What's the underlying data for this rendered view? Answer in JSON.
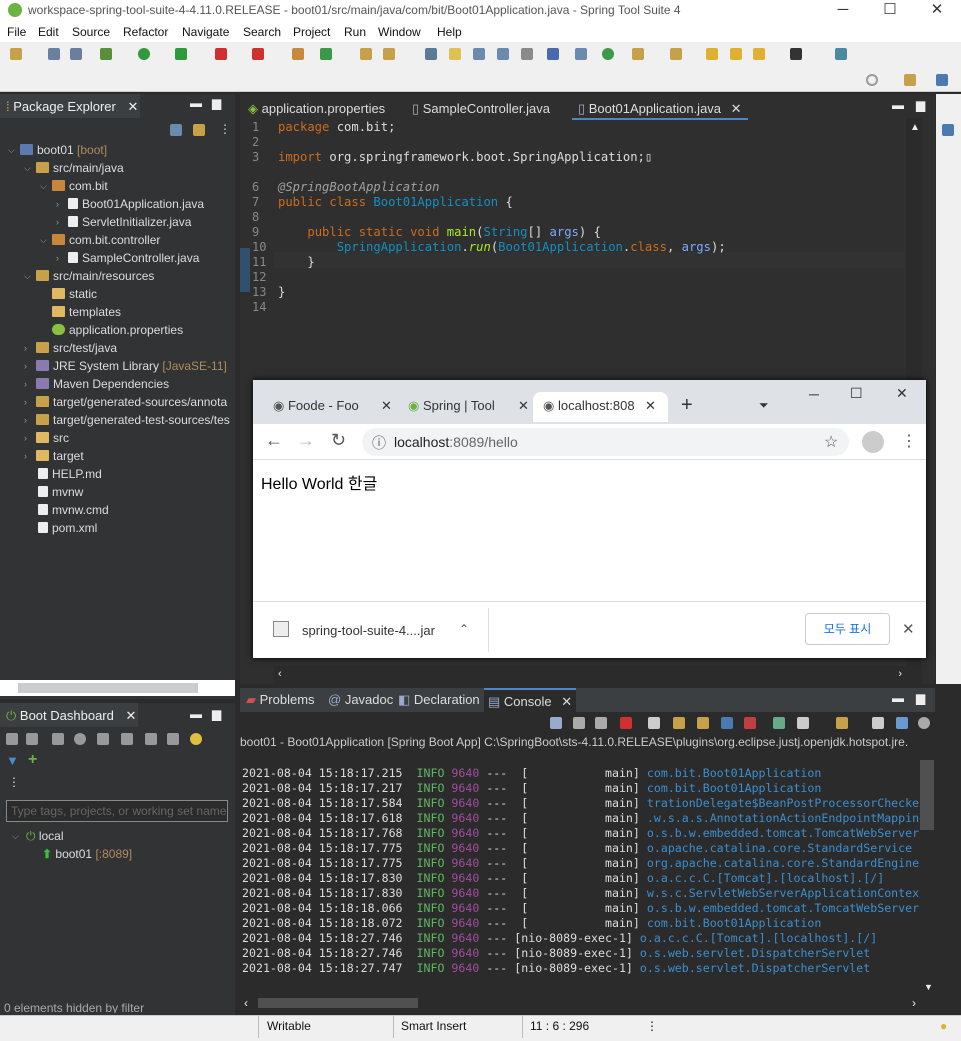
{
  "window": {
    "title": "workspace-spring-tool-suite-4-4.11.0.RELEASE - boot01/src/main/java/com/bit/Boot01Application.java - Spring Tool Suite 4",
    "minimize": "─",
    "maximize": "☐",
    "close": "✕"
  },
  "menu": [
    "File",
    "Edit",
    "Source",
    "Refactor",
    "Navigate",
    "Search",
    "Project",
    "Run",
    "Window",
    "Help"
  ],
  "package_explorer": {
    "title": "Package Explorer",
    "close": "✕",
    "items": [
      {
        "label": "boot01",
        "suffix": "[boot]"
      },
      {
        "label": "src/main/java"
      },
      {
        "label": "com.bit"
      },
      {
        "label": "Boot01Application.java"
      },
      {
        "label": "ServletInitializer.java"
      },
      {
        "label": "com.bit.controller"
      },
      {
        "label": "SampleController.java"
      },
      {
        "label": "src/main/resources"
      },
      {
        "label": "static"
      },
      {
        "label": "templates"
      },
      {
        "label": "application.properties"
      },
      {
        "label": "src/test/java"
      },
      {
        "label": "JRE System Library",
        "suffix": "[JavaSE-11]"
      },
      {
        "label": "Maven Dependencies"
      },
      {
        "label": "target/generated-sources/annota"
      },
      {
        "label": "target/generated-test-sources/tes"
      },
      {
        "label": "src"
      },
      {
        "label": "target"
      },
      {
        "label": "HELP.md"
      },
      {
        "label": "mvnw"
      },
      {
        "label": "mvnw.cmd"
      },
      {
        "label": "pom.xml"
      }
    ]
  },
  "editor": {
    "tabs": [
      "application.properties",
      "SampleController.java",
      "Boot01Application.java"
    ],
    "active_close": "✕",
    "line_numbers": [
      "1",
      "2",
      "3",
      "6",
      "7",
      "8",
      "9",
      "10",
      "11",
      "12",
      "13",
      "14"
    ]
  },
  "browser": {
    "tabs": [
      "Foode - Foo",
      "Spring | Tool",
      "localhost:808"
    ],
    "tab_close": "✕",
    "new_tab": "+",
    "url_host": "localhost",
    "url_rest": ":8089/hello",
    "content": "Hello World 한글",
    "download": {
      "file": "spring-tool-suite-4....jar",
      "show_all": "모두 표시",
      "close": "✕"
    },
    "window": {
      "min": "─",
      "max": "☐",
      "close": "✕"
    }
  },
  "boot_dashboard": {
    "title": "Boot Dashboard",
    "close": "✕",
    "filter_placeholder": "Type tags, projects, or working set name",
    "local": "local",
    "app": "boot01",
    "app_port": "[:8089]",
    "hidden": "0 elements hidden by filter"
  },
  "bottom_tabs": [
    "Problems",
    "Javadoc",
    "Declaration",
    "Console"
  ],
  "console": {
    "header": "boot01 - Boot01Application [Spring Boot App] C:\\SpringBoot\\sts-4.11.0.RELEASE\\plugins\\org.eclipse.justj.openjdk.hotspot.jre.",
    "lines": [
      {
        "ts": "2021-08-04 15:18:17.215",
        "lvl": "INFO",
        "pid": "9640",
        "thread": "---  [           main]",
        "logger": "com.bit.Boot01Application"
      },
      {
        "ts": "2021-08-04 15:18:17.217",
        "lvl": "INFO",
        "pid": "9640",
        "thread": "---  [           main]",
        "logger": "com.bit.Boot01Application"
      },
      {
        "ts": "2021-08-04 15:18:17.584",
        "lvl": "INFO",
        "pid": "9640",
        "thread": "---  [           main]",
        "logger": "trationDelegate$BeanPostProcessorChecker"
      },
      {
        "ts": "2021-08-04 15:18:17.618",
        "lvl": "INFO",
        "pid": "9640",
        "thread": "---  [           main]",
        "logger": ".w.s.a.s.AnnotationActionEndpointMapping"
      },
      {
        "ts": "2021-08-04 15:18:17.768",
        "lvl": "INFO",
        "pid": "9640",
        "thread": "---  [           main]",
        "logger": "o.s.b.w.embedded.tomcat.TomcatWebServer"
      },
      {
        "ts": "2021-08-04 15:18:17.775",
        "lvl": "INFO",
        "pid": "9640",
        "thread": "---  [           main]",
        "logger": "o.apache.catalina.core.StandardService"
      },
      {
        "ts": "2021-08-04 15:18:17.775",
        "lvl": "INFO",
        "pid": "9640",
        "thread": "---  [           main]",
        "logger": "org.apache.catalina.core.StandardEngine"
      },
      {
        "ts": "2021-08-04 15:18:17.830",
        "lvl": "INFO",
        "pid": "9640",
        "thread": "---  [           main]",
        "logger": "o.a.c.c.C.[Tomcat].[localhost].[/]"
      },
      {
        "ts": "2021-08-04 15:18:17.830",
        "lvl": "INFO",
        "pid": "9640",
        "thread": "---  [           main]",
        "logger": "w.s.c.ServletWebServerApplicationContext"
      },
      {
        "ts": "2021-08-04 15:18:18.066",
        "lvl": "INFO",
        "pid": "9640",
        "thread": "---  [           main]",
        "logger": "o.s.b.w.embedded.tomcat.TomcatWebServer"
      },
      {
        "ts": "2021-08-04 15:18:18.072",
        "lvl": "INFO",
        "pid": "9640",
        "thread": "---  [           main]",
        "logger": "com.bit.Boot01Application"
      },
      {
        "ts": "2021-08-04 15:18:27.746",
        "lvl": "INFO",
        "pid": "9640",
        "thread": "--- [nio-8089-exec-1]",
        "logger": "o.a.c.c.C.[Tomcat].[localhost].[/]"
      },
      {
        "ts": "2021-08-04 15:18:27.746",
        "lvl": "INFO",
        "pid": "9640",
        "thread": "--- [nio-8089-exec-1]",
        "logger": "o.s.web.servlet.DispatcherServlet"
      },
      {
        "ts": "2021-08-04 15:18:27.747",
        "lvl": "INFO",
        "pid": "9640",
        "thread": "--- [nio-8089-exec-1]",
        "logger": "o.s.web.servlet.DispatcherServlet"
      }
    ]
  },
  "status": {
    "writable": "Writable",
    "insert": "Smart Insert",
    "position": "11 : 6 : 296"
  }
}
